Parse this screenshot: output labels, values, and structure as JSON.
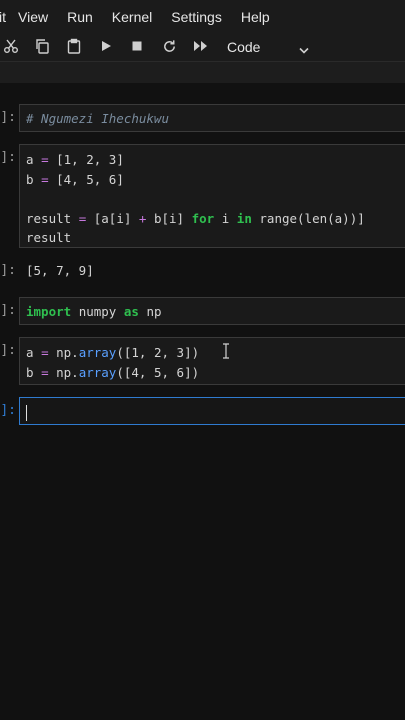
{
  "menu": {
    "items": [
      "it",
      "View",
      "Run",
      "Kernel",
      "Settings",
      "Help"
    ]
  },
  "toolbar": {
    "cell_type": "Code",
    "icons": [
      "cut-icon",
      "copy-icon",
      "paste-icon",
      "run-icon",
      "stop-icon",
      "restart-icon",
      "fast-forward-icon",
      "chevron-down-icon"
    ]
  },
  "prompts": {
    "in": "]:",
    "out": "]:"
  },
  "cells": {
    "c1": {
      "comment": "# Ngumezi Ihechukwu"
    },
    "c2": {
      "l1_var": "a",
      "l1_eq": "=",
      "l1_val": "[1, 2, 3]",
      "l2_var": "b",
      "l2_eq": "=",
      "l2_val": "[4, 5, 6]",
      "l3_a": "result",
      "l3_eq": "=",
      "l3_b": "[a[i]",
      "l3_plus": "+",
      "l3_c": "b[i]",
      "l3_for": "for",
      "l3_d": "i",
      "l3_in": "in",
      "l3_e": "range(len(a))]",
      "l4": "result"
    },
    "c2_output": "[5, 7, 9]",
    "c3": {
      "import": "import",
      "mod": "numpy",
      "as": "as",
      "alias": "np"
    },
    "c4": {
      "l1_var": "a",
      "l1_eq": "=",
      "l1_np": "np.",
      "l1_fn": "array",
      "l1_args": "([1, 2, 3])",
      "l2_var": "b",
      "l2_eq": "=",
      "l2_np": "np.",
      "l2_fn": "array",
      "l2_args": "([4, 5, 6])"
    }
  }
}
